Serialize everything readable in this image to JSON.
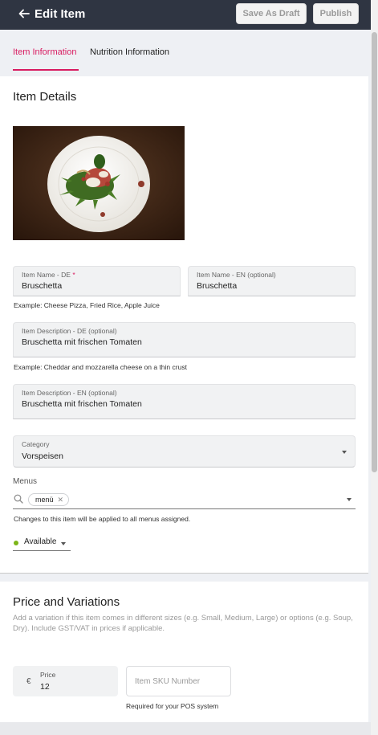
{
  "header": {
    "title": "Edit Item",
    "save_draft_label": "Save As Draft",
    "publish_label": "Publish"
  },
  "tabs": [
    {
      "label": "Item Information",
      "active": true
    },
    {
      "label": "Nutrition Information",
      "active": false
    }
  ],
  "item_details": {
    "title": "Item Details",
    "name_de": {
      "label": "Item Name - DE",
      "required_mark": "*",
      "value": "Bruschetta"
    },
    "name_en": {
      "label": "Item Name - EN (optional)",
      "value": "Bruschetta"
    },
    "name_helper": "Example: Cheese Pizza, Fried Rice, Apple Juice",
    "desc_de": {
      "label": "Item Description - DE (optional)",
      "value": "Bruschetta mit frischen Tomaten"
    },
    "desc_helper": "Example: Cheddar and mozzarella cheese on a thin crust",
    "desc_en": {
      "label": "Item Description - EN (optional)",
      "value": "Bruschetta mit frischen Tomaten"
    },
    "category": {
      "label": "Category",
      "value": "Vorspeisen"
    },
    "menus": {
      "label": "Menus",
      "chips": [
        "menü"
      ],
      "helper": "Changes to this item will be applied to all menus assigned."
    },
    "availability": "Available"
  },
  "price_section": {
    "title": "Price and Variations",
    "description": "Add a variation if this item comes in different sizes (e.g. Small, Medium, Large) or options (e.g. Soup, Dry). Include GST/VAT in prices if applicable.",
    "currency_symbol": "€",
    "price_label": "Price",
    "price_value": "12",
    "sku_placeholder": "Item SKU Number",
    "sku_helper": "Required for your POS system"
  },
  "colors": {
    "topbar": "#2f3542",
    "accent": "#d81b60",
    "available": "#7cb518"
  }
}
